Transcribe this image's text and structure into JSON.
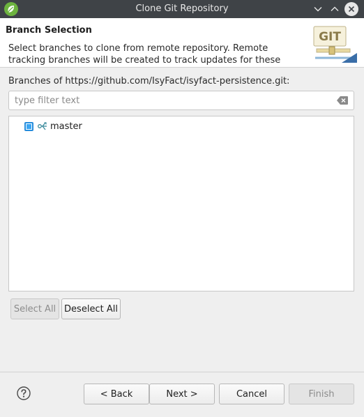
{
  "window": {
    "title": "Clone Git Repository",
    "app_icon": "spring-leaf-icon",
    "controls": [
      "chevron-down-icon",
      "chevron-up-icon",
      "close-icon"
    ]
  },
  "banner": {
    "heading": "Branch Selection",
    "description": "Select branches to clone from remote repository. Remote tracking branches will be created to track updates for these branches in the",
    "graphic_text": "GIT"
  },
  "branches": {
    "label": "Branches of https://github.com/IsyFact/isyfact-persistence.git:",
    "filter_placeholder": "type filter text",
    "filter_value": "",
    "items": [
      {
        "name": "master",
        "checked": true,
        "icon": "branch-icon"
      }
    ]
  },
  "selection_buttons": {
    "select_all": "Select All",
    "deselect_all": "Deselect All"
  },
  "footer": {
    "help_icon": "help-icon",
    "back": "< Back",
    "next": "Next >",
    "cancel": "Cancel",
    "finish": "Finish"
  },
  "colors": {
    "titlebar": "#3f4347",
    "checkbox_accent": "#1f8fe0",
    "spring_green": "#6db33f"
  }
}
